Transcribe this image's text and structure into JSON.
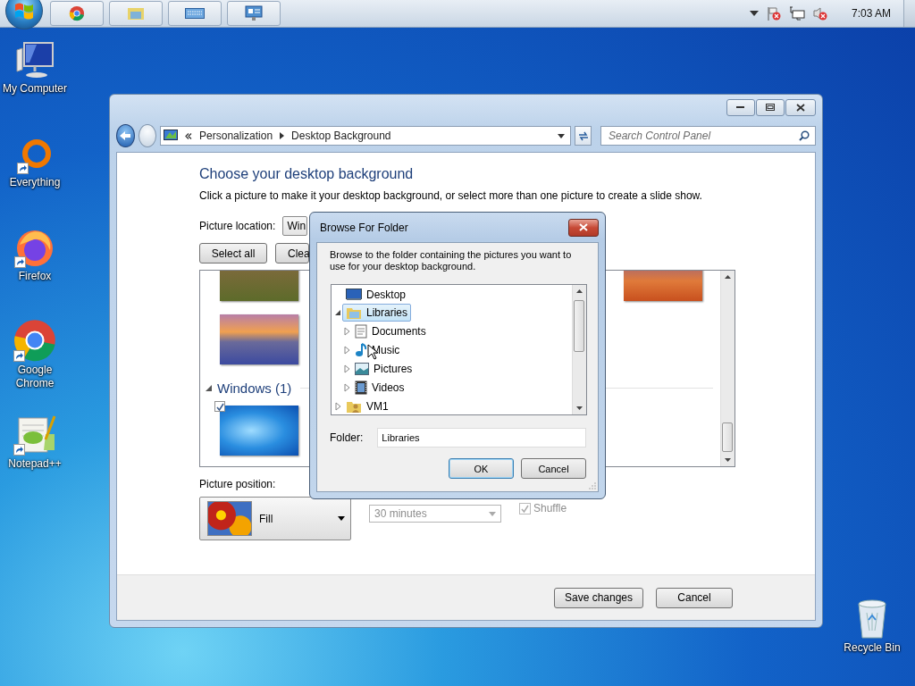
{
  "taskbar": {
    "apps": [
      {
        "kind": "chrome"
      },
      {
        "kind": "explorer"
      },
      {
        "kind": "keyboard"
      },
      {
        "kind": "remote"
      }
    ],
    "tray": [
      {
        "kind": "caret"
      },
      {
        "kind": "flag-error"
      },
      {
        "kind": "network"
      },
      {
        "kind": "volume-muted"
      }
    ],
    "clock": "7:03 AM"
  },
  "desktop_icons": [
    {
      "label": "My Computer",
      "kind": "computer",
      "shortcut": false
    },
    {
      "label": "Everything",
      "kind": "everything",
      "shortcut": true
    },
    {
      "label": "Firefox",
      "kind": "firefox",
      "shortcut": true
    },
    {
      "label": "Google Chrome",
      "kind": "chrome",
      "shortcut": true
    },
    {
      "label": "Notepad++",
      "kind": "notepad",
      "shortcut": true
    }
  ],
  "recycle_bin": {
    "label": "Recycle Bin"
  },
  "window": {
    "breadcrumb": [
      "Personalization",
      "Desktop Background"
    ],
    "search_placeholder": "Search Control Panel",
    "heading": "Choose your desktop background",
    "description": "Click a picture to make it your desktop background, or select more than one picture to create a slide show.",
    "location_label": "Picture location:",
    "location_value": "Win",
    "buttons": [
      "Select all",
      "Clea"
    ],
    "group": {
      "title": "Windows (1)",
      "expanded": true,
      "items": [
        {
          "checked": true
        }
      ]
    },
    "position_label": "Picture position:",
    "position_value": "Fill",
    "interval": {
      "value": "30 minutes",
      "disabled": true
    },
    "shuffle": {
      "label": "Shuffle",
      "checked": true,
      "disabled": true
    },
    "footer_buttons": [
      "Save changes",
      "Cancel"
    ]
  },
  "dialog": {
    "title": "Browse For Folder",
    "instructions": "Browse to the folder containing the pictures you want to use for your desktop background.",
    "tree": [
      {
        "label": "Desktop",
        "kind": "desktop",
        "selected": false,
        "children": [
          {
            "label": "Libraries",
            "kind": "library",
            "selected": true,
            "expanded": true,
            "children": [
              {
                "label": "Documents",
                "kind": "documents",
                "selected": false,
                "expanded": false
              },
              {
                "label": "Music",
                "kind": "music",
                "selected": false,
                "expanded": false
              },
              {
                "label": "Pictures",
                "kind": "pictures",
                "selected": false,
                "expanded": false
              },
              {
                "label": "Videos",
                "kind": "videos",
                "selected": false,
                "expanded": false
              }
            ]
          },
          {
            "label": "VM1",
            "kind": "user-folder",
            "selected": false,
            "expanded": false
          }
        ]
      }
    ],
    "folder_label": "Folder:",
    "folder_value": "Libraries",
    "buttons": [
      "OK",
      "Cancel"
    ]
  }
}
